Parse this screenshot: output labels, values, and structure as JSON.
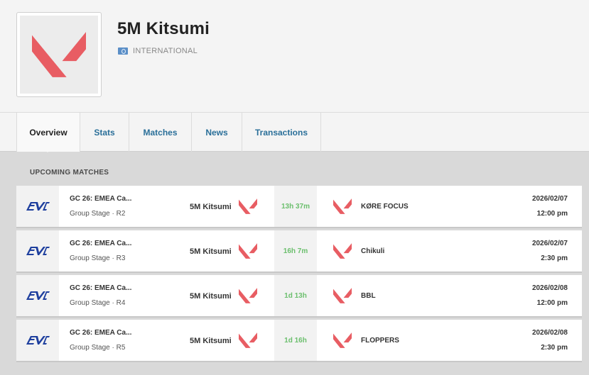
{
  "team": {
    "name": "5M Kitsumi",
    "country": "INTERNATIONAL",
    "logo_icon": "valorant-logo-icon",
    "brand_color": "#e85d63"
  },
  "tabs": [
    {
      "label": "Overview",
      "active": true
    },
    {
      "label": "Stats",
      "active": false
    },
    {
      "label": "Matches",
      "active": false
    },
    {
      "label": "News",
      "active": false
    },
    {
      "label": "Transactions",
      "active": false
    }
  ],
  "upcoming": {
    "title": "UPCOMING MATCHES",
    "eta_color": "#6bbf6d",
    "matches": [
      {
        "event": "GC 26: EMEA Ca...",
        "stage": "Group Stage · R2",
        "team1": "5M Kitsumi",
        "eta": "13h 37m",
        "team2": "KØRE FOCUS",
        "date": "2026/02/07",
        "time": "12:00 pm"
      },
      {
        "event": "GC 26: EMEA Ca...",
        "stage": "Group Stage · R3",
        "team1": "5M Kitsumi",
        "eta": "16h 7m",
        "team2": "Chikuli",
        "date": "2026/02/07",
        "time": "2:30 pm"
      },
      {
        "event": "GC 26: EMEA Ca...",
        "stage": "Group Stage · R4",
        "team1": "5M Kitsumi",
        "eta": "1d 13h",
        "team2": "BBL",
        "date": "2026/02/08",
        "time": "12:00 pm"
      },
      {
        "event": "GC 26: EMEA Ca...",
        "stage": "Group Stage · R5",
        "team1": "5M Kitsumi",
        "eta": "1d 16h",
        "team2": "FLOPPERS",
        "date": "2026/02/08",
        "time": "2:30 pm"
      }
    ]
  }
}
